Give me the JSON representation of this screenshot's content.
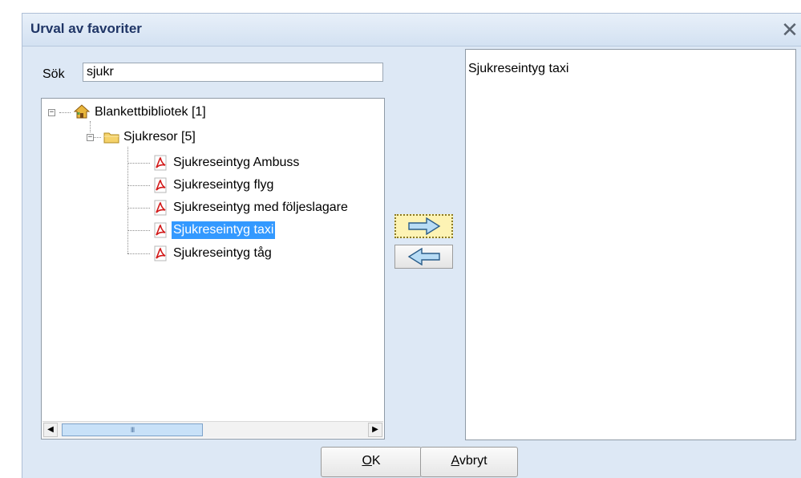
{
  "dialog": {
    "title": "Urval av favoriter",
    "close_symbol": "✕"
  },
  "search": {
    "label": "Sök",
    "value": "sjukr"
  },
  "tree": {
    "root": {
      "label": "Blankettbibliotek [1]",
      "icon": "home-icon",
      "expander": "⊟"
    },
    "folder": {
      "label": "Sjukresor [5]",
      "icon": "folder-icon",
      "expander": "⊟"
    },
    "items": [
      {
        "label": "Sjukreseintyg Ambuss",
        "icon": "pdf-icon",
        "selected": false
      },
      {
        "label": "Sjukreseintyg flyg",
        "icon": "pdf-icon",
        "selected": false
      },
      {
        "label": "Sjukreseintyg med följeslagare",
        "icon": "pdf-icon",
        "selected": false
      },
      {
        "label": "Sjukreseintyg taxi",
        "icon": "pdf-icon",
        "selected": true
      },
      {
        "label": "Sjukreseintyg tåg",
        "icon": "pdf-icon",
        "selected": false
      }
    ],
    "hscroll": {
      "left_arrow": "◀",
      "right_arrow": "▶",
      "thumb_grip": "III"
    }
  },
  "transfer": {
    "add_icon": "arrow-right-icon",
    "remove_icon": "arrow-left-icon",
    "arrow_fill": "#b8dcf5",
    "arrow_stroke": "#2a5d8a"
  },
  "selected_favorites": [
    "Sjukreseintyg taxi"
  ],
  "buttons": {
    "ok_mnemonic": "O",
    "ok_rest": "K",
    "cancel_mnemonic": "A",
    "cancel_rest": "vbryt"
  },
  "colors": {
    "selection": "#3399ff",
    "title_text": "#1f3566",
    "pdf_red": "#d21919",
    "folder_yellow": "#f5d26a"
  }
}
